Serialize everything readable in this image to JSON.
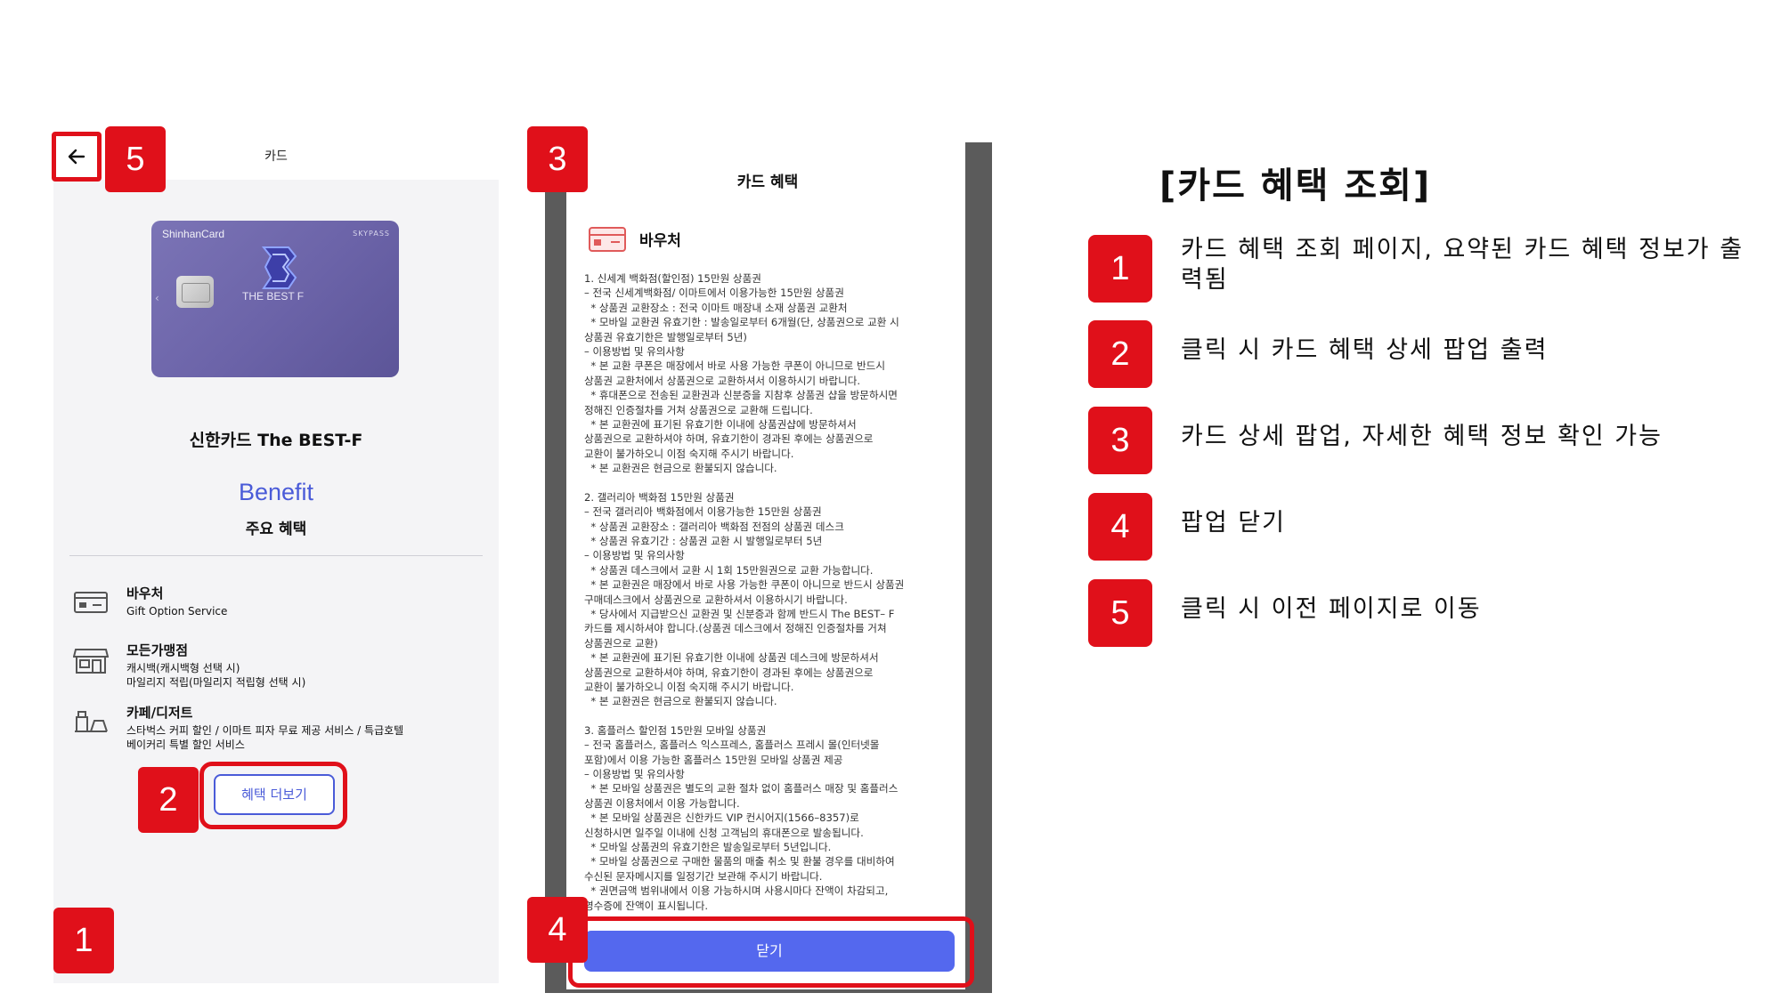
{
  "screen1": {
    "title": "카드",
    "card_image": {
      "brand": "ShinhanCard",
      "tag": "SKYPASS",
      "name": "THE BEST F"
    },
    "card_name": "신한카드 The BEST-F",
    "benefit_heading": "Benefit",
    "benefit_subheading": "주요 혜택",
    "benefits": [
      {
        "title": "바우처",
        "lines": [
          "Gift Option Service"
        ],
        "icon": "voucher-icon"
      },
      {
        "title": "모든가맹점",
        "lines": [
          "캐시백(캐시백형 선택 시)",
          "마일리지 적립(마일리지 적립형 선택 시)"
        ],
        "icon": "store-icon"
      },
      {
        "title": "카페/디저트",
        "lines": [
          "스타벅스 커피 할인 / 이마트 피자 무료 제공 서비스 / 특급호텔",
          "베이커리 특별 할인 서비스"
        ],
        "icon": "cafe-icon"
      }
    ],
    "more_button": "혜택 더보기"
  },
  "popup": {
    "title": "카드 혜택",
    "subtitle": "바우처",
    "paragraphs": [
      "1. 신세계 백화점(할인점) 15만원 상품권\n– 전국 신세계백화점/ 이마트에서 이용가능한 15만원 상품권\n  * 상품권 교환장소 : 전국 이마트 매장내 소재 상품권 교환처\n  * 모바일 교환권 유효기한 : 발송일로부터 6개월(단, 상품권으로 교환 시\n상품권 유효기한은 발행일로부터 5년)\n– 이용방법 및 유의사항\n  * 본 교환 쿠폰은 매장에서 바로 사용 가능한 쿠폰이 아니므로 반드시\n상품권 교환처에서 상품권으로 교환하셔서 이용하시기 바랍니다.\n  * 휴대폰으로 전송된 교환권과 신분증을 지참후 상품권 샵을 방문하시면\n정해진 인증절차를 거쳐 상품권으로 교환해 드립니다.\n  * 본 교환권에 표기된 유효기한 이내에 상품권샵에 방문하셔서\n상품권으로 교환하셔야 하며, 유효기한이 경과된 후에는 상품권으로\n교환이 불가하오니 이점 숙지해 주시기 바랍니다.\n  * 본 교환권은 현금으로 환불되지 않습니다.",
      "2. 갤러리아 백화점 15만원 상품권\n– 전국 갤러리아 백화점에서 이용가능한 15만원 상품권\n  * 상품권 교환장소 : 갤러리아 백화점 전점의 상품권 데스크\n  * 상품권 유효기간 : 상품권 교환 시 발행일로부터 5년\n– 이용방법 및 유의사항\n  * 상품권 데스크에서 교환 시 1회 15만원권으로 교환 가능합니다.\n  * 본 교환권은 매장에서 바로 사용 가능한 쿠폰이 아니므로 반드시 상품권\n구매데스크에서 상품권으로 교환하셔서 이용하시기 바랍니다.\n  * 당사에서 지급받으신 교환권 및 신분증과 함께 반드시 The BEST– F\n카드를 제시하셔야 합니다.(상품권 데스크에서 정해진 인증절차를 거쳐\n상품권으로 교환)\n  * 본 교환권에 표기된 유효기한 이내에 상품권 데스크에 방문하셔서\n상품권으로 교환하셔야 하며, 유효기한이 경과된 후에는 상품권으로\n교환이 불가하오니 이점 숙지해 주시기 바랍니다.\n  * 본 교환권은 현금으로 환불되지 않습니다.",
      "3. 홈플러스 할인점 15만원 모바일 상품권\n– 전국 홈플러스, 홈플러스 익스프레스, 홈플러스 프레시 몰(인터넷몰\n포함)에서 이용 가능한 홈플러스 15만원 모바일 상품권 제공\n– 이용방법 및 유의사항\n  * 본 모바일 상품권은 별도의 교환 절차 없이 홈플러스 매장 및 홈플러스\n상품권 이용처에서 이용 가능합니다.\n  * 본 모바일 상품권은 신한카드 VIP 컨시어지(1566–8357)로\n신청하시면 일주일 이내에 신청 고객님의 휴대폰으로 발송됩니다.\n  * 모바일 상품권의 유효기한은 발송일로부터 5년입니다.\n  * 모바일 상품권으로 구매한 물품의 매출 취소 및 환불 경우를 대비하여\n수신된 문자메시지를 일정기간 보관해 주시기 바랍니다.\n  * 권면금액 범위내에서 이용 가능하시며 사용시마다 잔액이 차감되고,\n영수증에 잔액이 표시됩니다."
    ],
    "close_button": "닫기"
  },
  "badges": {
    "b1": "1",
    "b2": "2",
    "b3": "3",
    "b4": "4",
    "b5": "5"
  },
  "annotations": {
    "title": "[카드 혜택 조회]",
    "items": [
      {
        "num": "1",
        "text": "카드 혜택 조회 페이지, 요약된 카드 혜택 정보가 출력됨"
      },
      {
        "num": "2",
        "text": "클릭 시 카드 혜택 상세 팝업 출력"
      },
      {
        "num": "3",
        "text": "카드 상세 팝업, 자세한 혜택 정보 확인 가능"
      },
      {
        "num": "4",
        "text": "팝업 닫기"
      },
      {
        "num": "5",
        "text": "클릭 시 이전 페이지로 이동"
      }
    ]
  },
  "colors": {
    "accent": "#4a5bd8",
    "highlight": "#e0101a",
    "close_button": "#5468ee",
    "card": "#6b63a8"
  }
}
